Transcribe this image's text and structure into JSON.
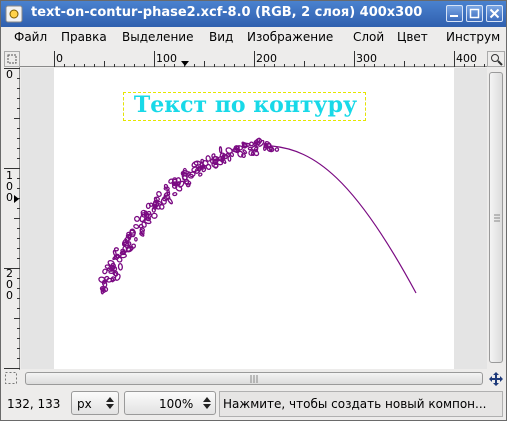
{
  "window": {
    "title": "text-on-contur-phase2.xcf-8.0 (RGB, 2 слоя) 400x300"
  },
  "menu": [
    "Файл",
    "Правка",
    "Выделение",
    "Вид",
    "Изображение",
    "Слой",
    "Цвет",
    "Инструм"
  ],
  "rulers": {
    "horizontal_labels": [
      "0",
      "100",
      "200",
      "300",
      "400"
    ],
    "vertical_labels": [
      "0",
      "100",
      "200"
    ]
  },
  "canvas": {
    "text_layer": "Текст по контуру",
    "text_color": "#18d9e8",
    "path_color": "#7a0a82"
  },
  "statusbar": {
    "coords": "132, 133",
    "unit": "px",
    "zoom": "100%",
    "message": "Нажмите, чтобы создать новый компон..."
  }
}
